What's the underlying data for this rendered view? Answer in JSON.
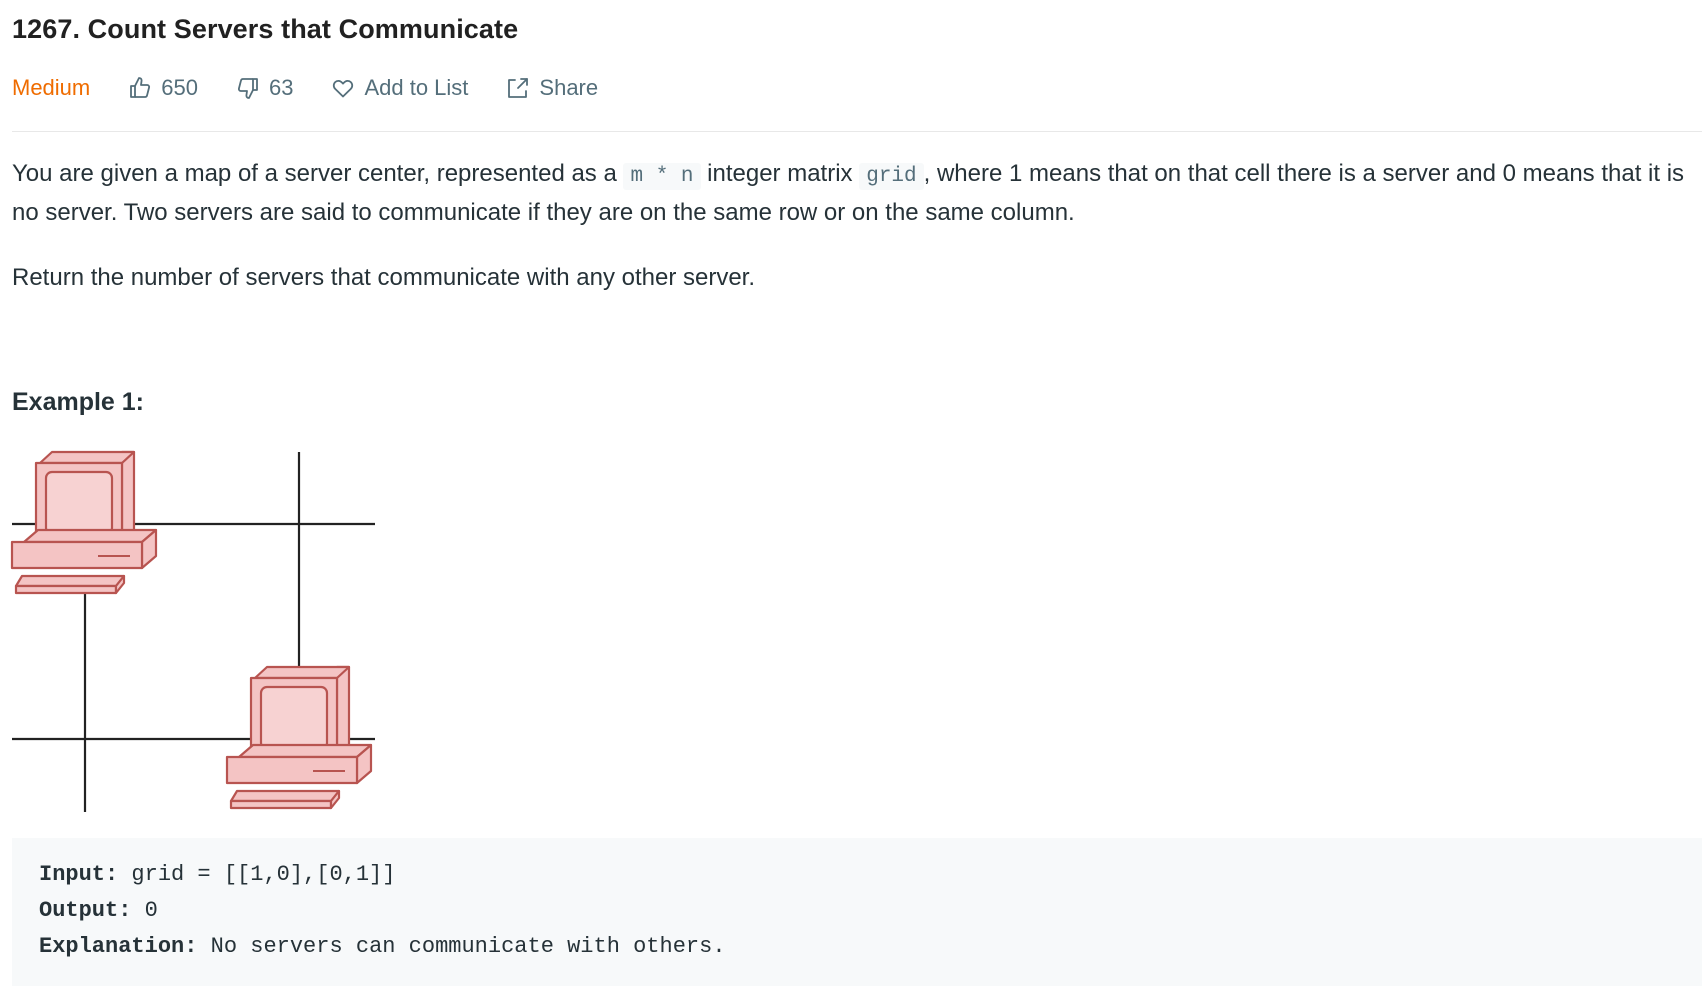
{
  "problem": {
    "title": "1267. Count Servers that Communicate",
    "difficulty": "Medium",
    "likes": "650",
    "dislikes": "63",
    "add_to_list_label": "Add to List",
    "share_label": "Share",
    "difficulty_color": "#ef6c00"
  },
  "description": {
    "p1_part1": "You are given a map of a server center, represented as a ",
    "p1_code1": "m * n",
    "p1_part2": " integer matrix ",
    "p1_code2": "grid",
    "p1_part3": ", where 1 means that on that cell there is a server and 0 means that it is no server. Two servers are said to communicate if they are on the same row or on the same column.",
    "p2": "Return the number of servers that communicate with any other server."
  },
  "example1": {
    "heading": "Example 1:",
    "input_label": "Input:",
    "input_value": " grid = [[1,0],[0,1]]",
    "output_label": "Output:",
    "output_value": " 0",
    "explanation_label": "Explanation:",
    "explanation_value": " No servers can communicate with others."
  },
  "icons": {
    "like": "thumbs-up-icon",
    "dislike": "thumbs-down-icon",
    "add_to_list": "heart-icon",
    "share": "share-icon"
  },
  "colors": {
    "server_fill": "#f4c4c4",
    "server_stroke": "#b85450"
  }
}
